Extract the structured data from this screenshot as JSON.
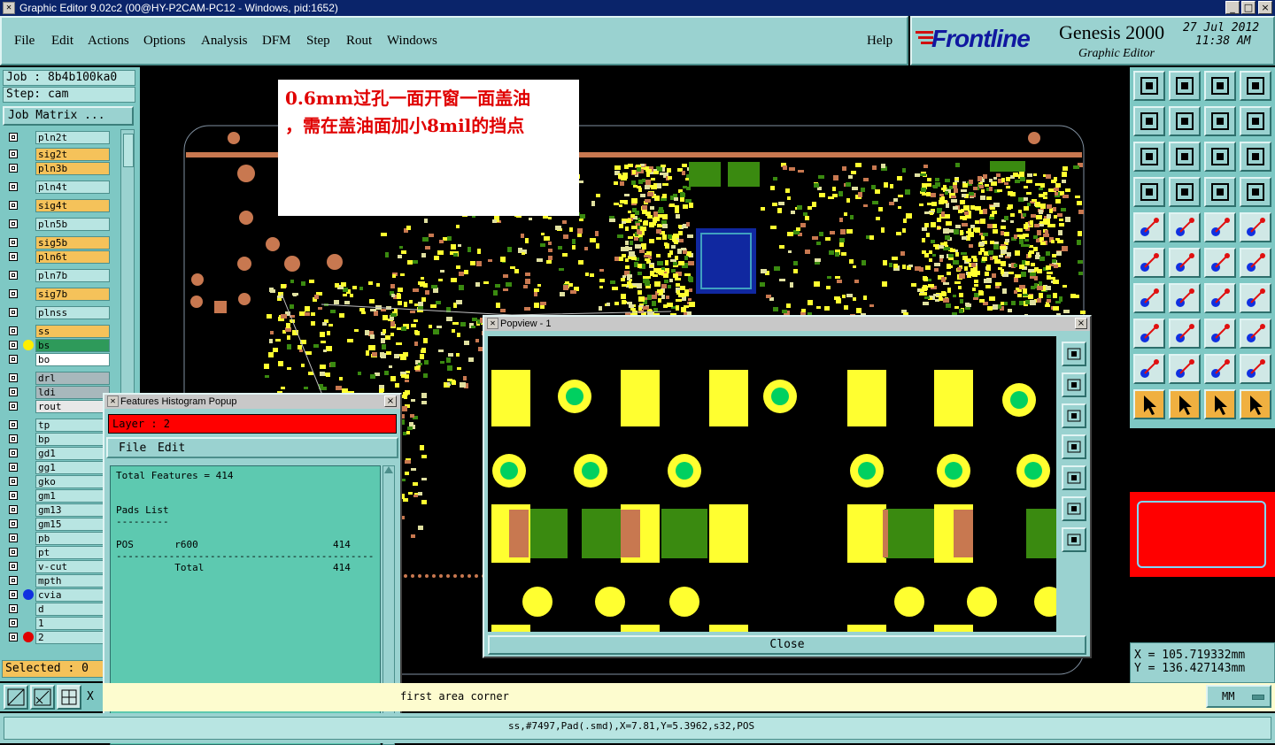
{
  "window": {
    "title": "Graphic Editor 9.02c2 (00@HY-P2CAM-PC12 - Windows, pid:1652)",
    "min": "_",
    "max": "□",
    "close": "×"
  },
  "menu": {
    "items": [
      "File",
      "Edit",
      "Actions",
      "Options",
      "Analysis",
      "DFM",
      "Step",
      "Rout",
      "Windows"
    ],
    "help": "Help"
  },
  "brand": {
    "logo": "Frontline",
    "product": "Genesis 2000",
    "subtitle": "Graphic Editor",
    "date": "27 Jul 2012",
    "time": "11:38 AM"
  },
  "job": {
    "job_line": "Job : 8b4b100ka0",
    "step_line": "Step: cam",
    "matrix_button": "Job Matrix ..."
  },
  "layers": [
    {
      "name": "pln2t",
      "color": "#b8e5e2",
      "dot": ""
    },
    {
      "name": "sig2t",
      "color": "#f5c25a",
      "dot": ""
    },
    {
      "name": "pln3b",
      "color": "#f5c25a",
      "dot": ""
    },
    {
      "name": "pln4t",
      "color": "#b8e5e2",
      "dot": ""
    },
    {
      "name": "sig4t",
      "color": "#f5c25a",
      "dot": ""
    },
    {
      "name": "pln5b",
      "color": "#b8e5e2",
      "dot": ""
    },
    {
      "name": "sig5b",
      "color": "#f5c25a",
      "dot": ""
    },
    {
      "name": "pln6t",
      "color": "#f5c25a",
      "dot": ""
    },
    {
      "name": "pln7b",
      "color": "#b8e5e2",
      "dot": ""
    },
    {
      "name": "sig7b",
      "color": "#f5c25a",
      "dot": ""
    },
    {
      "name": "plnss",
      "color": "#b8e5e2",
      "dot": ""
    },
    {
      "name": "ss",
      "color": "#f5c25a",
      "dot": ""
    },
    {
      "name": "bs",
      "color": "#2e9a5a",
      "dot": "#ffee00"
    },
    {
      "name": "bo",
      "color": "#ffffff",
      "dot": ""
    },
    {
      "name": "drl",
      "color": "#a8b8bc",
      "dot": ""
    },
    {
      "name": "ldi",
      "color": "#a8b8bc",
      "dot": ""
    },
    {
      "name": "rout",
      "color": "#e8e8e8",
      "dot": ""
    },
    {
      "name": "tp",
      "color": "#b8e5e2",
      "dot": ""
    },
    {
      "name": "bp",
      "color": "#b8e5e2",
      "dot": ""
    },
    {
      "name": "gd1",
      "color": "#b8e5e2",
      "dot": ""
    },
    {
      "name": "gg1",
      "color": "#b8e5e2",
      "dot": ""
    },
    {
      "name": "gko",
      "color": "#b8e5e2",
      "dot": ""
    },
    {
      "name": "gm1",
      "color": "#b8e5e2",
      "dot": ""
    },
    {
      "name": "gm13",
      "color": "#b8e5e2",
      "dot": ""
    },
    {
      "name": "gm15",
      "color": "#b8e5e2",
      "dot": ""
    },
    {
      "name": "pb",
      "color": "#b8e5e2",
      "dot": ""
    },
    {
      "name": "pt",
      "color": "#b8e5e2",
      "dot": ""
    },
    {
      "name": "v-cut",
      "color": "#b8e5e2",
      "dot": ""
    },
    {
      "name": "mpth",
      "color": "#b8e5e2",
      "dot": ""
    },
    {
      "name": "cvia",
      "color": "#b8e5e2",
      "dot": "#1030e0"
    },
    {
      "name": "d",
      "color": "#b8e5e2",
      "dot": ""
    },
    {
      "name": "1",
      "color": "#b8e5e2",
      "dot": ""
    },
    {
      "name": "2",
      "color": "#b8e5e2",
      "dot": "#e00000"
    }
  ],
  "selected": "Selected : 0",
  "annotation": {
    "line1": "0.6mm过孔一面开窗一面盖油",
    "line2": "，需在盖油面加小8mil的挡点"
  },
  "histogram": {
    "title": "Features Histogram Popup",
    "layer_label": "Layer :  2",
    "menu": [
      "File",
      "Edit"
    ],
    "lines": [
      "Total Features = 414",
      "",
      "",
      "Pads List",
      "---------",
      "",
      "POS       r600                       414",
      "--------------------------------------------",
      "          Total                      414"
    ]
  },
  "popview": {
    "title": "Popview - 1",
    "close_button": "Close"
  },
  "coords": {
    "x": "X = 105.719332mm",
    "y": "Y = 136.427143mm"
  },
  "status": {
    "prompt_prefix": "X",
    "prompt": "first area corner",
    "units": "MM",
    "feature_info": "ss,#7497,Pad(.smd),X=7.81,Y=5.3962,s32,POS"
  },
  "colors": {
    "panel": "#7ec8c4",
    "pad_yellow": "#ffff30",
    "pad_green": "#3a8a10",
    "via_green": "#00d060",
    "copper": "#c87850"
  }
}
